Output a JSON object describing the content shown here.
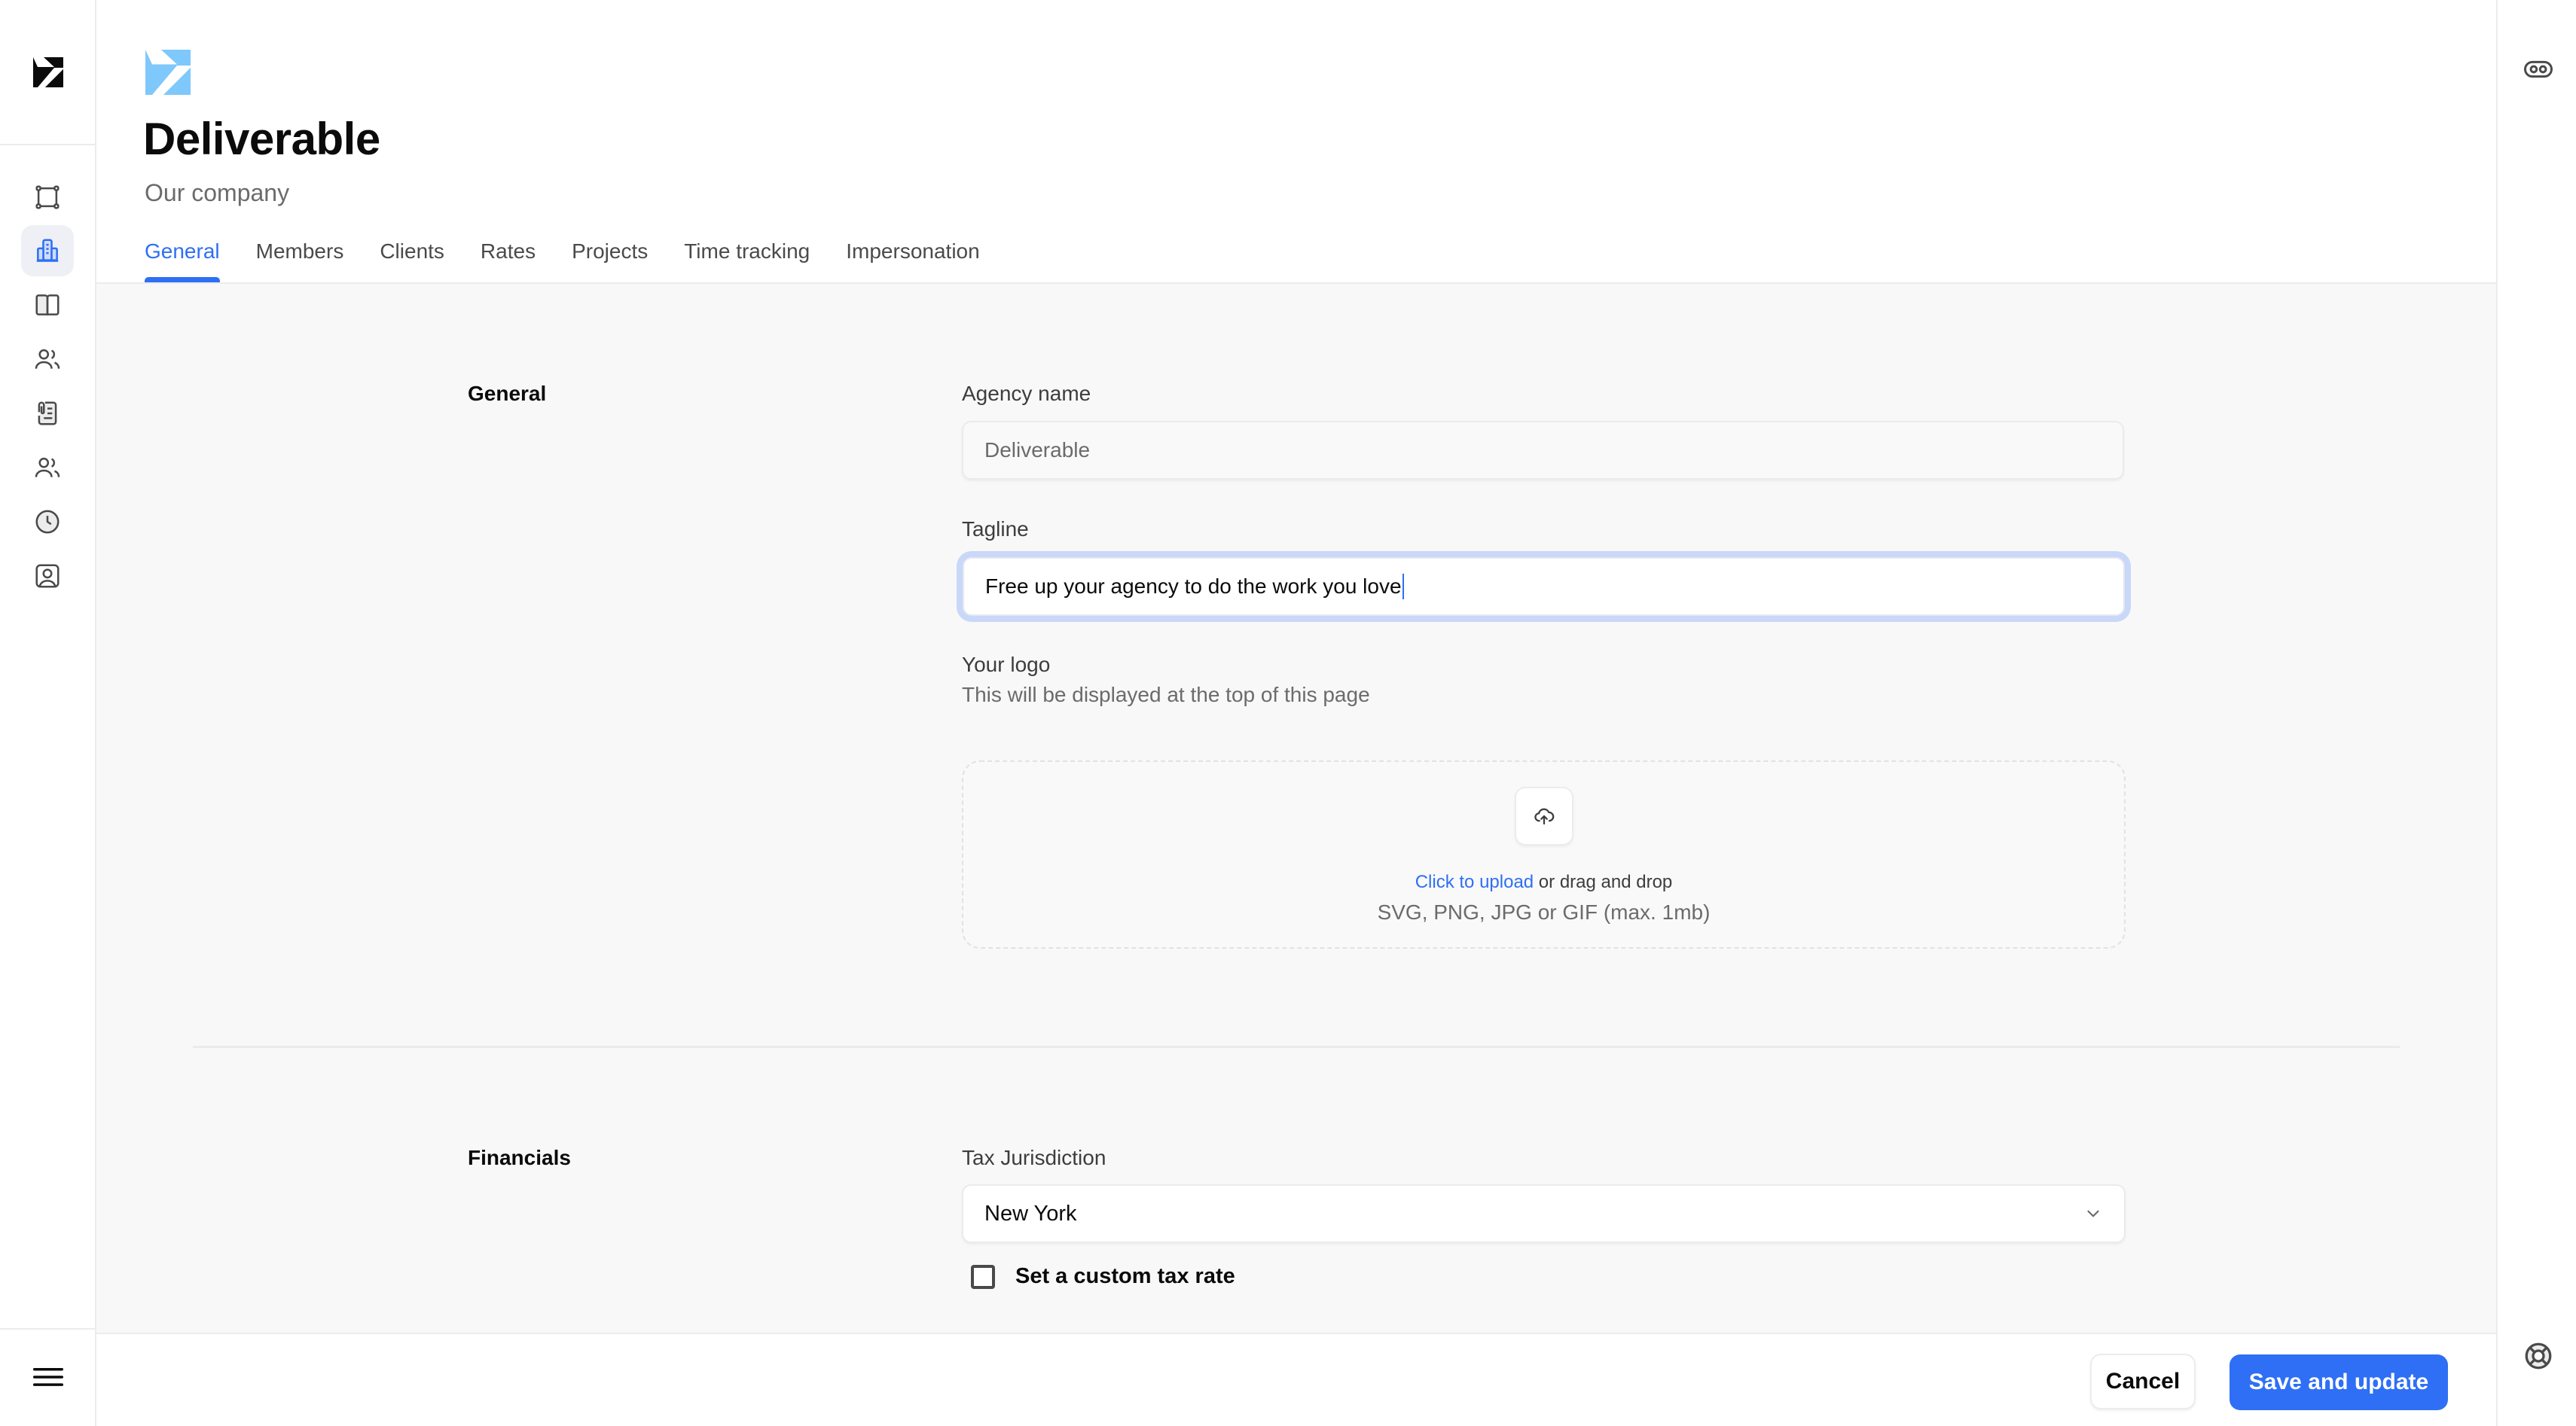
{
  "sidebar": {
    "brand_icon": "deliverable-logo",
    "items": [
      {
        "name": "projects-frame",
        "icon": "frame-icon",
        "active": false
      },
      {
        "name": "company",
        "icon": "building-icon",
        "active": true
      },
      {
        "name": "library",
        "icon": "book-open-icon",
        "active": false
      },
      {
        "name": "people",
        "icon": "users-icon",
        "active": false
      },
      {
        "name": "documents",
        "icon": "clipboard-attachment-icon",
        "active": false
      },
      {
        "name": "team",
        "icon": "users-icon",
        "active": false
      },
      {
        "name": "time",
        "icon": "clock-icon",
        "active": false
      },
      {
        "name": "profile",
        "icon": "user-square-icon",
        "active": false
      }
    ],
    "menu_icon": "hamburger-menu-icon"
  },
  "rail": {
    "top_icon": "impersonate-toggle-icon",
    "bottom_icon": "life-buoy-icon"
  },
  "header": {
    "company_logo": "company-logo",
    "title": "Deliverable",
    "subtitle": "Our company",
    "tabs": [
      {
        "label": "General",
        "active": true
      },
      {
        "label": "Members",
        "active": false
      },
      {
        "label": "Clients",
        "active": false
      },
      {
        "label": "Rates",
        "active": false
      },
      {
        "label": "Projects",
        "active": false
      },
      {
        "label": "Time tracking",
        "active": false
      },
      {
        "label": "Impersonation",
        "active": false
      }
    ]
  },
  "general": {
    "section_label": "General",
    "agency_name": {
      "label": "Agency name",
      "value": "Deliverable"
    },
    "tagline": {
      "label": "Tagline",
      "value": "Free up your agency to do the work you love"
    },
    "logo": {
      "label": "Your logo",
      "help": "This will be displayed at the top of this page",
      "upload_icon": "cloud-upload-icon",
      "upload_link": "Click to upload",
      "upload_rest": " or drag and drop",
      "upload_hint": "SVG, PNG, JPG or GIF (max. 1mb)"
    }
  },
  "financials": {
    "section_label": "Financials",
    "tax_jurisdiction": {
      "label": "Tax Jurisdiction",
      "value": "New York"
    },
    "custom_tax": {
      "label": "Set a custom tax rate",
      "checked": false
    }
  },
  "footer": {
    "cancel_label": "Cancel",
    "save_label": "Save and update"
  },
  "colors": {
    "accent": "#2e6ff5",
    "logo_blue": "#7fc8fb",
    "focus_ring": "#c9d7f8",
    "content_bg": "#f8f8f8"
  }
}
